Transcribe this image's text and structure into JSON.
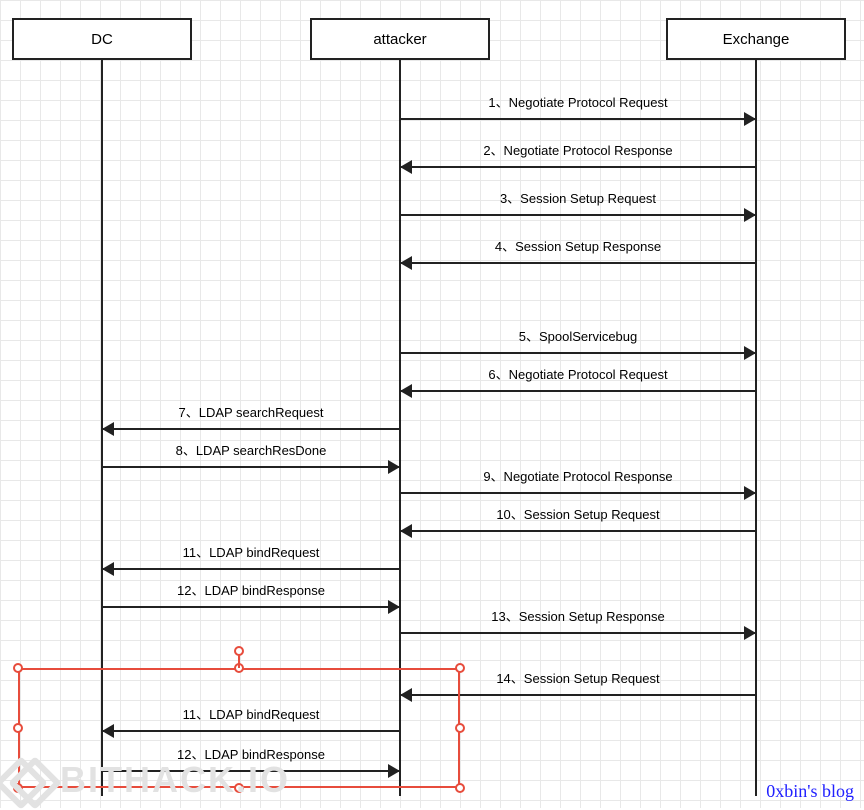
{
  "actors": {
    "dc": "DC",
    "attacker": "attacker",
    "exchange": "Exchange"
  },
  "messages": {
    "m1": "1、Negotiate Protocol Request",
    "m2": "2、Negotiate Protocol Response",
    "m3": "3、Session Setup Request",
    "m4": "4、Session Setup Response",
    "m5": "5、SpoolServicebug",
    "m6": "6、Negotiate Protocol Request",
    "m7": "7、LDAP searchRequest",
    "m8": "8、LDAP searchResDone",
    "m9": "9、Negotiate Protocol Response",
    "m10": "10、Session Setup Request",
    "m11": "11、LDAP bindRequest",
    "m12": "12、LDAP bindResponse",
    "m13": "13、Session Setup Response",
    "m14": "14、Session Setup Request",
    "m15": "11、LDAP bindRequest",
    "m16": "12、LDAP bindResponse"
  },
  "watermark": "BITHACK.IO",
  "credit": "0xbin's blog"
}
